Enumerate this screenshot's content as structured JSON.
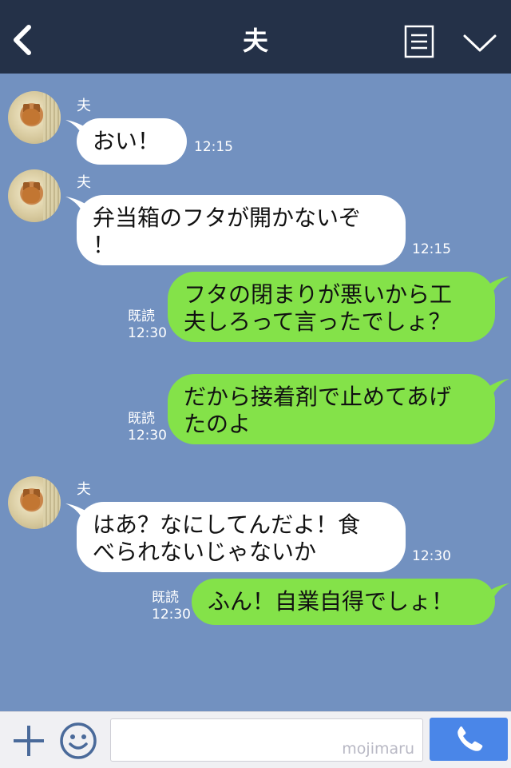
{
  "header": {
    "title": "夫"
  },
  "messages": [
    {
      "side": "left",
      "sender": "夫",
      "lines": [
        "おい！"
      ],
      "time": "12:15"
    },
    {
      "side": "left",
      "sender": "夫",
      "lines": [
        "弁当箱のフタが開かないぞ",
        "！"
      ],
      "time": "12:15"
    },
    {
      "side": "right",
      "read": "既読",
      "lines": [
        "フタの閉まりが悪いから工",
        "夫しろって言ったでしょ？"
      ],
      "time": "12:30"
    },
    {
      "side": "right",
      "read": "既読",
      "lines": [
        "だから接着剤で止めてあげ",
        "たのよ"
      ],
      "time": "12:30"
    },
    {
      "side": "left",
      "sender": "夫",
      "lines": [
        "はあ？なにしてんだよ！食",
        "べられないじゃないか"
      ],
      "time": "12:30"
    },
    {
      "side": "right",
      "read": "既読",
      "lines": [
        "ふん！自業自得でしょ！"
      ],
      "time": "12:30"
    }
  ],
  "footer": {
    "watermark": "mojimaru"
  },
  "colors": {
    "header": "#243148",
    "background": "#7291c0",
    "my_bubble": "#84e249",
    "their_bubble": "#ffffff",
    "call_button": "#4a86e8"
  },
  "icons": [
    "back-icon",
    "menu-icon",
    "chevron-down-icon",
    "plus-icon",
    "smile-icon",
    "phone-icon"
  ]
}
